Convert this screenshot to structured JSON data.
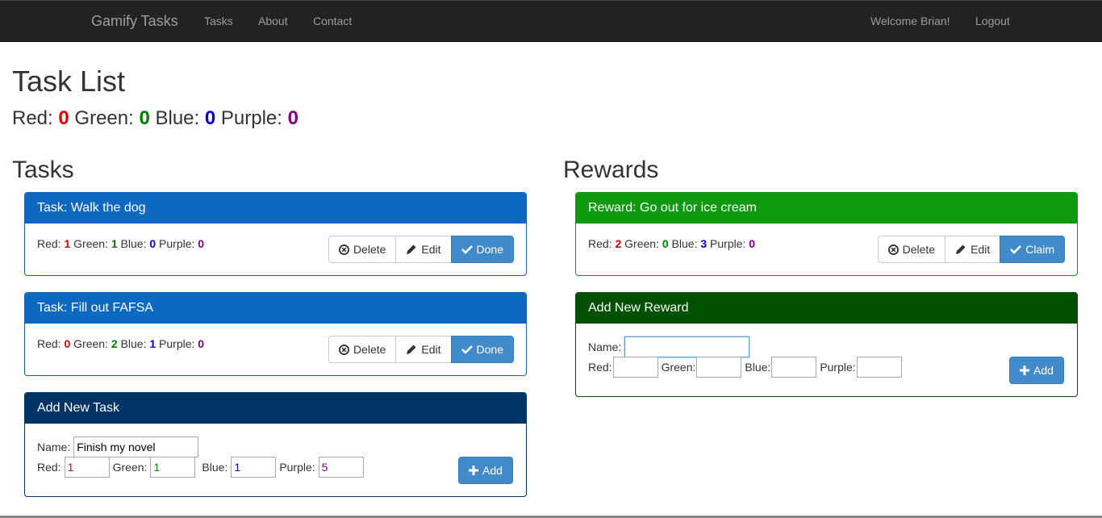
{
  "nav": {
    "brand": "Gamify Tasks",
    "links": [
      "Tasks",
      "About",
      "Contact"
    ],
    "welcome": "Welcome Brian!",
    "logout": "Logout"
  },
  "page": {
    "title": "Task List",
    "points": {
      "red_label": "Red:",
      "red": "0",
      "green_label": "Green:",
      "green": "0",
      "blue_label": "Blue:",
      "blue": "0",
      "purple_label": "Purple:",
      "purple": "0"
    }
  },
  "tasks": {
    "heading": "Tasks",
    "items": [
      {
        "title": "Task: Walk the dog",
        "red": "1",
        "green": "1",
        "blue": "0",
        "purple": "0"
      },
      {
        "title": "Task: Fill out FAFSA",
        "red": "0",
        "green": "2",
        "blue": "1",
        "purple": "0"
      }
    ],
    "labels": {
      "red": "Red:",
      "green": "Green:",
      "blue": "Blue:",
      "purple": "Purple:"
    },
    "buttons": {
      "delete": "Delete",
      "edit": "Edit",
      "done": "Done"
    },
    "add_form": {
      "title": "Add New Task",
      "name_label": "Name:",
      "name_value": "Finish my novel",
      "red_label": "Red:",
      "red_value": "1",
      "green_label": "Green:",
      "green_value": "1",
      "blue_label": "Blue:",
      "blue_value": "1",
      "purple_label": "Purple:",
      "purple_value": "5",
      "add_label": "Add"
    }
  },
  "rewards": {
    "heading": "Rewards",
    "items": [
      {
        "title": "Reward: Go out for ice cream",
        "red": "2",
        "green": "0",
        "blue": "3",
        "purple": "0"
      }
    ],
    "buttons": {
      "delete": "Delete",
      "edit": "Edit",
      "claim": "Claim"
    },
    "add_form": {
      "title": "Add New Reward",
      "name_label": "Name:",
      "name_value": "",
      "red_label": "Red:",
      "red_value": "",
      "green_label": "Green:",
      "green_value": "",
      "blue_label": "Blue:",
      "blue_value": "",
      "purple_label": "Purple:",
      "purple_value": "",
      "add_label": "Add"
    }
  },
  "colors": {
    "task_header": "#0d68c0",
    "add_task_header": "#003366",
    "reward_header": "#0e9a0e",
    "add_reward_header": "#005000",
    "primary": "#428bca",
    "navbar": "#222222"
  },
  "icons": {
    "delete": "circle-x-icon",
    "edit": "pencil-icon",
    "done": "checkmark-icon",
    "claim": "checkmark-icon",
    "add": "plus-icon"
  }
}
